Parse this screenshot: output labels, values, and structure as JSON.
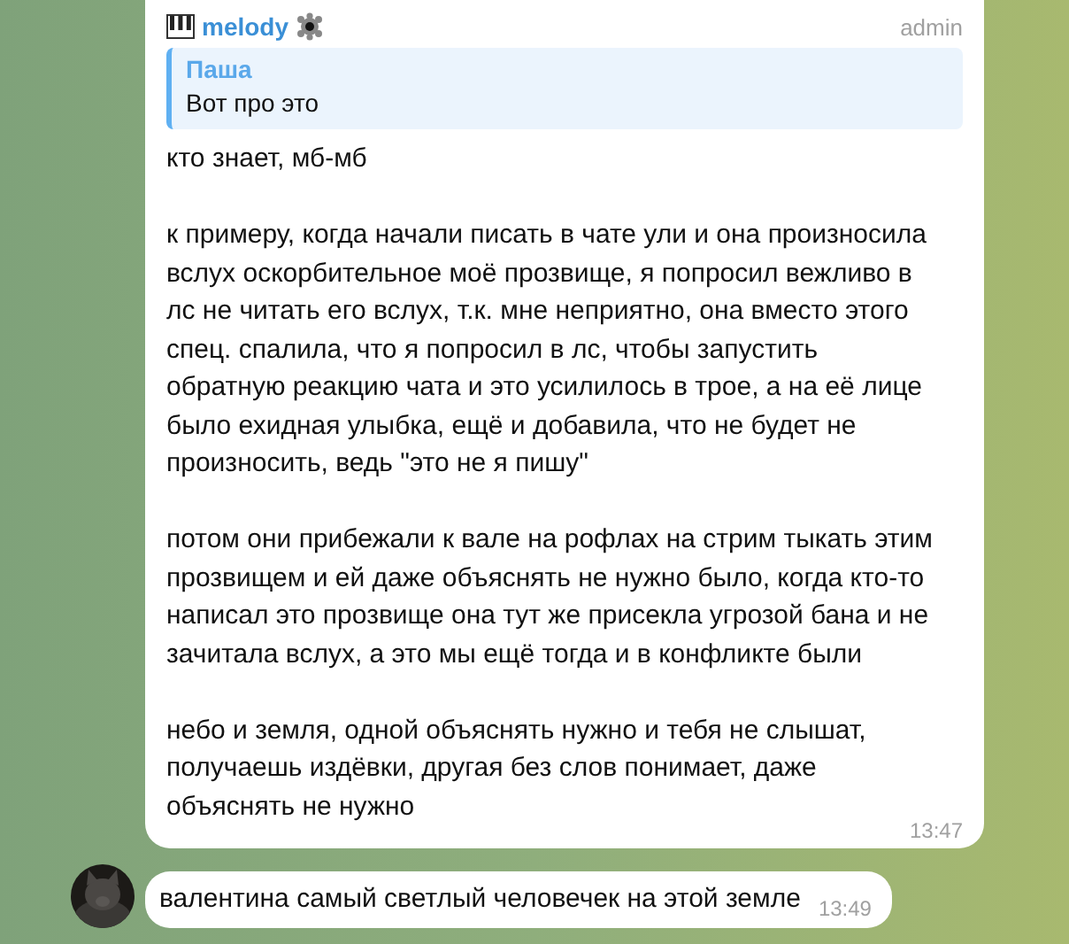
{
  "messages": [
    {
      "kind": "group",
      "author": "melody",
      "role": "admin",
      "reply": {
        "author": "Паша",
        "text": "Вот про это"
      },
      "paragraphs": [
        "кто знает, мб-мб",
        "к примеру, когда начали писать в чате ули и она произносила вслух оскорбительное моё прозвище, я попросил вежливо в лс не читать его вслух, т.к. мне неприятно, она вместо этого спец. спалила, что я попросил в лс, чтобы запустить обратную реакцию чата и это усилилось в трое, а на её лице было ехидная улыбка, ещё и добавила, что не будет не произносить, ведь \"это не я пишу\"",
        "потом они прибежали к вале на рофлах на стрим тыкать этим прозвищем и ей даже объяснять не нужно было, когда кто-то написал это прозвище она тут же присекла угрозой бана и не зачитала вслух, а это мы ещё тогда и в конфликте были",
        "небо и земля, одной объяснять нужно и тебя не слышат, получаешь издёвки, другая без слов понимает, даже объяснять не нужно"
      ],
      "time": "13:47"
    },
    {
      "kind": "single",
      "avatar": {
        "kind": "picture"
      },
      "paragraphs": [
        "валентина самый светлый человечек на этой земле"
      ],
      "time": "13:49"
    }
  ]
}
